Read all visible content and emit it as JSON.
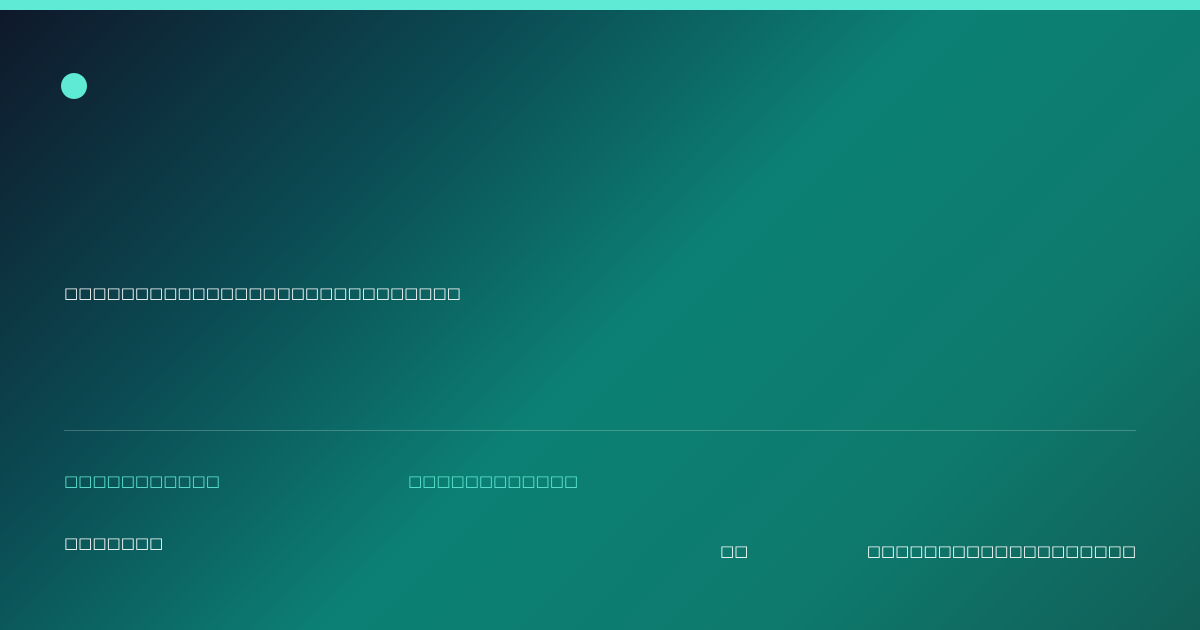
{
  "card": {
    "headline": "□□□□□□□□□□□□□□□□□□□□□□□□□□□□",
    "meta_left": "□□□□□□□□□□□",
    "meta_mid": "□□□□□□□□□□□□",
    "author": "□□□□□□□",
    "tag": "□□",
    "site": "□□□□□□□□□□□□□□□□□□□"
  },
  "colors": {
    "accent": "#5eead4",
    "background_start": "#0f172a",
    "background_mid": "#0c8074",
    "background_end": "#115e56",
    "text": "#ffffff"
  },
  "icons": {
    "logo": "circle-logo-icon"
  }
}
